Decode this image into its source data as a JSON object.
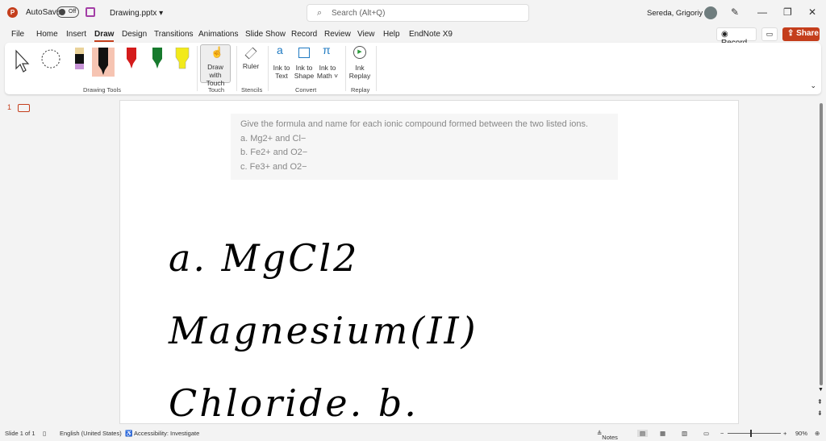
{
  "titlebar": {
    "logo": "P",
    "autosave": "AutoSave",
    "autosave_state": "Off",
    "filename": "Drawing.pptx ▾",
    "search_placeholder": "Search (Alt+Q)",
    "user": "Sereda, Grigoriy A"
  },
  "tabs": [
    "File",
    "Home",
    "Insert",
    "Draw",
    "Design",
    "Transitions",
    "Animations",
    "Slide Show",
    "Record",
    "Review",
    "View",
    "Help",
    "EndNote X9"
  ],
  "active_tab": "Draw",
  "actions": {
    "record": "Record",
    "share": "Share"
  },
  "ribbon": {
    "draw_with_touch": "Draw with Touch",
    "ruler": "Ruler",
    "ink_to_text": "Ink to Text",
    "ink_to_shape": "Ink to Shape",
    "ink_to_math": "Ink to Math ˅",
    "ink_replay": "Ink Replay",
    "groups": {
      "drawing_tools": "Drawing Tools",
      "touch": "Touch",
      "stencils": "Stencils",
      "convert": "Convert",
      "replay": "Replay"
    }
  },
  "thumbnail_number": "1",
  "slide": {
    "lines": [
      "Give the formula and name for each ionic compound formed between the two listed ions.",
      "a. Mg2+ and Cl−",
      "b. Fe2+ and O2−",
      "c. Fe3+ and O2−"
    ],
    "handwriting": "a. MgCl2 Magnesium(II) Chloride. b."
  },
  "status": {
    "slide": "Slide 1 of 1",
    "language": "English (United States)",
    "accessibility": "Accessibility: Investigate",
    "notes": "Notes",
    "zoom": "90%"
  },
  "colors": {
    "accent": "#c43e1c"
  }
}
